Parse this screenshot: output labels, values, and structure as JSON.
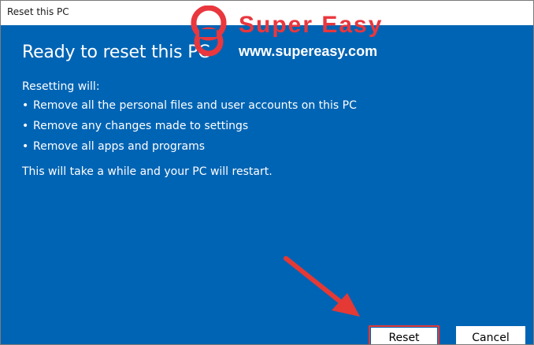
{
  "window": {
    "title": "Reset this PC"
  },
  "main": {
    "heading": "Ready to reset this PC",
    "intro": "Resetting will:",
    "bullets": [
      "Remove all the personal files and user accounts on this PC",
      "Remove any changes made to settings",
      "Remove all apps and programs"
    ],
    "closing": "This will take a while and your PC will restart."
  },
  "watermark": {
    "brand": "Super Easy",
    "url": "www.supereasy.com"
  },
  "buttons": {
    "reset_label": "Reset",
    "cancel_label": "Cancel"
  },
  "colors": {
    "background": "#0064b4",
    "highlight": "#e53935",
    "watermark_red": "#e9373e"
  },
  "icons": {
    "bullet": "bullet-dot",
    "watermark_logo": "supereasy-logo-icon",
    "annotation_arrow": "red-arrow-icon"
  }
}
